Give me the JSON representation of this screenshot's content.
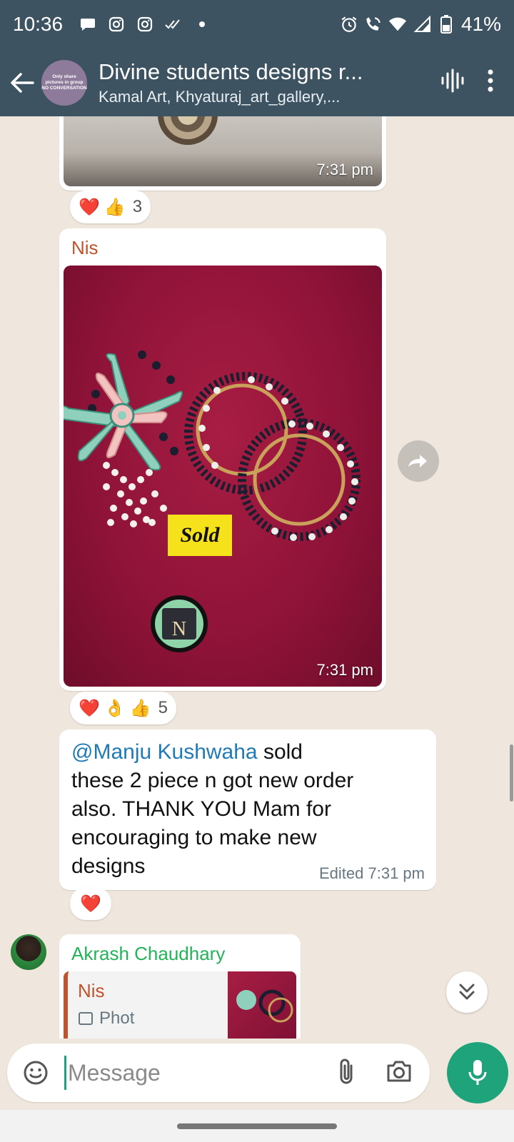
{
  "status_bar": {
    "time": "10:36",
    "battery": "41%",
    "left_icons": [
      "chat-bubble-icon",
      "instagram-icon",
      "instagram-icon",
      "double-check-icon",
      "dot-icon"
    ],
    "right_icons": [
      "alarm-icon",
      "wifi-call-icon",
      "wifi-icon",
      "signal-icon",
      "battery-icon"
    ]
  },
  "header": {
    "avatar_text_line1": "Only share",
    "avatar_text_line2": "pictures in group",
    "avatar_text_line3": "NO CONVERSATION",
    "title": "Divine students designs r...",
    "subtitle": "Kamal Art, Khyaturaj_art_gallery,..."
  },
  "messages": [
    {
      "type": "image",
      "timestamp": "7:31 pm",
      "reactions": {
        "emojis": [
          "❤️",
          "👍"
        ],
        "count": "3"
      }
    },
    {
      "type": "image",
      "sender": "Nis",
      "sender_color": "#c0532c",
      "image_badge": "Sold",
      "timestamp": "7:31 pm",
      "reactions": {
        "emojis": [
          "❤️",
          "👌",
          "👍"
        ],
        "count": "5"
      }
    },
    {
      "type": "text",
      "mention": "@Manju Kushwaha",
      "text_line1": " sold",
      "text_line2": "these 2 piece n got new order",
      "text_line3": "also. THANK YOU Mam for",
      "text_line4": "encouraging to make new",
      "text_line5": "designs",
      "edited_label": "Edited",
      "timestamp": "7:31 pm",
      "reactions": {
        "emojis": [
          "❤️"
        ],
        "count": ""
      }
    },
    {
      "type": "reply",
      "sender": "Akrash Chaudhary",
      "sender_color": "#25b35a",
      "quoted_sender": "Nis",
      "quoted_preview": "Phot"
    }
  ],
  "input": {
    "placeholder": "Message"
  },
  "colors": {
    "header_bg": "#3d5361",
    "accent_green": "#1fa37a",
    "chat_bg": "#efe7dd"
  }
}
